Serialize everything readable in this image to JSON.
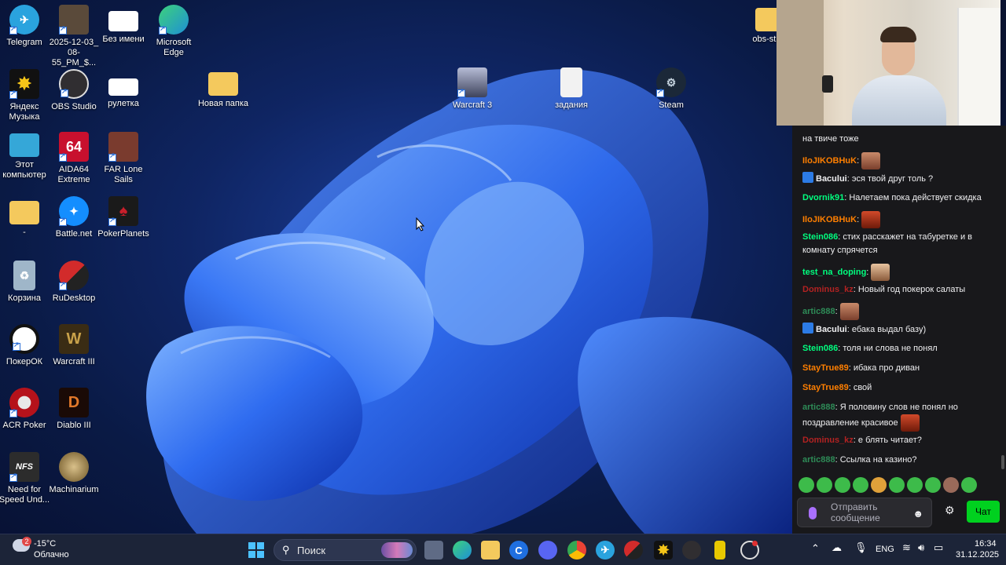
{
  "desktop_icons": [
    {
      "label": "Telegram",
      "icon": "telegram-icon",
      "color": "#2aa3de"
    },
    {
      "label": "2025-12-03_\n08-55_PM_$...",
      "icon": "game-capture-icon",
      "color": "#5a4a3a"
    },
    {
      "label": "Без имени",
      "icon": "paint-file-icon",
      "color": "#ffffff"
    },
    {
      "label": "Microsoft\nEdge",
      "icon": "edge-icon",
      "color": "#1e8fd6"
    },
    {
      "label": "Яндекс\nМузыка",
      "icon": "yandex-music-icon",
      "color": "#f5c518"
    },
    {
      "label": "OBS Studio",
      "icon": "obs-icon",
      "color": "#302e31"
    },
    {
      "label": "рулетка",
      "icon": "roulette-file-icon",
      "color": "#ffffff"
    },
    {
      "label": "Новая папка",
      "icon": "folder-icon",
      "color": "#f4c95d"
    },
    {
      "label": "Warcraft 3",
      "icon": "warcraft3-icon",
      "color": "#6a6f88"
    },
    {
      "label": "задания",
      "icon": "text-file-icon",
      "color": "#f2f2f2"
    },
    {
      "label": "Steam",
      "icon": "steam-icon",
      "color": "#1b2838"
    },
    {
      "label": "Этот\nкомпьютер",
      "icon": "this-pc-icon",
      "color": "#35a7d8"
    },
    {
      "label": "AIDA64\nExtreme",
      "icon": "aida64-icon",
      "color": "#c8102e"
    },
    {
      "label": "FAR Lone\nSails",
      "icon": "far-lone-sails-icon",
      "color": "#7a3b2e"
    },
    {
      "label": "-",
      "icon": "folder-icon",
      "color": "#f4c95d"
    },
    {
      "label": "Battle.net",
      "icon": "battlenet-icon",
      "color": "#148eff"
    },
    {
      "label": "PokerPlanets",
      "icon": "pokerplanets-icon",
      "color": "#c91f2b"
    },
    {
      "label": "Корзина",
      "icon": "recycle-bin-icon",
      "color": "#9fb6c9"
    },
    {
      "label": "RuDesktop",
      "icon": "rudesktop-icon",
      "color": "#d22b2b"
    },
    {
      "label": "ПокерОК",
      "icon": "pokerok-icon",
      "color": "#111111"
    },
    {
      "label": "Warcraft III",
      "icon": "warcraft-iii-icon",
      "color": "#c9a24a"
    },
    {
      "label": "ACR Poker",
      "icon": "acr-poker-icon",
      "color": "#b5121b"
    },
    {
      "label": "Diablo III",
      "icon": "diablo-iii-icon",
      "color": "#8a2a12"
    },
    {
      "label": "Need for\nSpeed Und...",
      "icon": "nfs-icon",
      "color": "#2c2c2c"
    },
    {
      "label": "Machinarium",
      "icon": "machinarium-icon",
      "color": "#9a7a3a"
    },
    {
      "label": "obs-stu...",
      "icon": "folder-icon",
      "color": "#f4c95d"
    }
  ],
  "chat": {
    "messages": [
      {
        "user": "",
        "user_color": "#efeff1",
        "text": "на твиче тоже",
        "emote": false,
        "badge": false
      },
      {
        "user": "IloJIKOBHuK",
        "user_color": "#ff7f00",
        "text": "",
        "emote": true,
        "badge": false
      },
      {
        "user": "Bacului",
        "user_color": "#efeff1",
        "text": "эся твой друг толь ?",
        "emote": false,
        "badge": true
      },
      {
        "user": "Dvornik91",
        "user_color": "#00ff7f",
        "text": "Налетаем пока действует скидка",
        "emote": false,
        "badge": false
      },
      {
        "user": "IloJIKOBHuK",
        "user_color": "#ff7f00",
        "text": "",
        "emote": true,
        "badge": false
      },
      {
        "user": "Stein086",
        "user_color": "#00ff7f",
        "text": "стих расскажет на табуретке и в комнату спрячется",
        "emote": false,
        "badge": false
      },
      {
        "user": "test_na_doping",
        "user_color": "#00ff7f",
        "text": "",
        "emote": true,
        "badge": false
      },
      {
        "user": "Dominus_kz",
        "user_color": "#b22222",
        "text": "Новый год покерок салаты",
        "emote": false,
        "badge": false
      },
      {
        "user": "artic888",
        "user_color": "#2e8b57",
        "text": "",
        "emote": true,
        "badge": false
      },
      {
        "user": "Bacului",
        "user_color": "#efeff1",
        "text": "ебака выдал базу)",
        "emote": false,
        "badge": true
      },
      {
        "user": "Stein086",
        "user_color": "#00ff7f",
        "text": "толя ни слова не понял",
        "emote": false,
        "badge": false
      },
      {
        "user": "StayTrue89",
        "user_color": "#ff7f00",
        "text": "ибака про диван",
        "emote": false,
        "badge": false
      },
      {
        "user": "StayTrue89",
        "user_color": "#ff7f00",
        "text": "свой",
        "emote": false,
        "badge": false
      },
      {
        "user": "artic888",
        "user_color": "#2e8b57",
        "text": "Я половину слов не понял но поздравление красивое",
        "emote": true,
        "badge": false
      },
      {
        "user": "Dominus_kz",
        "user_color": "#b22222",
        "text": "е блять читает?",
        "emote": false,
        "badge": false
      },
      {
        "user": "artic888",
        "user_color": "#2e8b57",
        "text": "Ссылка на казино?",
        "emote": false,
        "badge": false
      }
    ],
    "input_placeholder": "Отправить сообщение",
    "send_label": "Чат"
  },
  "taskbar": {
    "weather_temp": "-15°C",
    "weather_desc": "Облачно",
    "weather_badge": "2",
    "search_label": "Поиск",
    "lang": "ENG",
    "time": "16:34",
    "date": "31.12.2025"
  }
}
